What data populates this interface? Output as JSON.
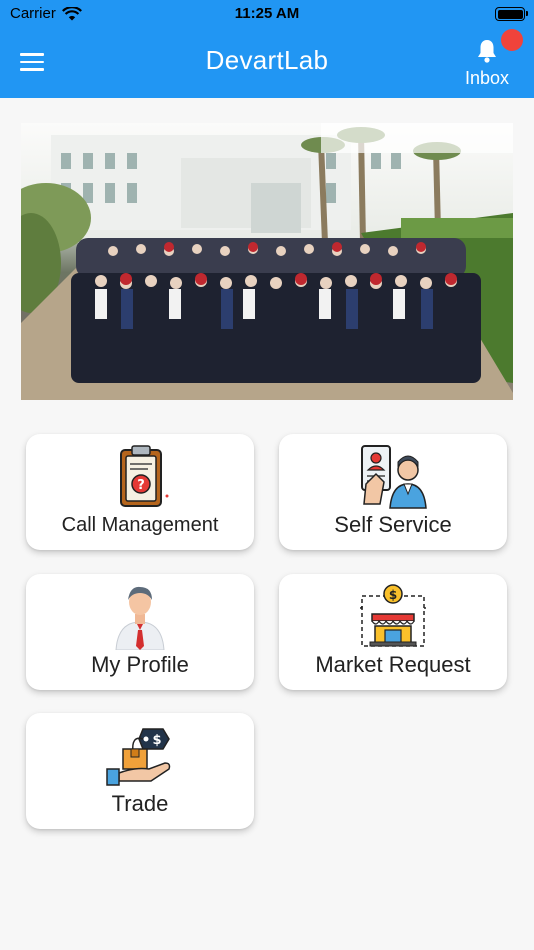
{
  "status_bar": {
    "carrier": "Carrier",
    "time": "11:25 AM"
  },
  "header": {
    "title": "DevartLab",
    "inbox_label": "Inbox",
    "accent_color": "#2196f3",
    "badge_color": "#f0433b"
  },
  "banner": {
    "description_icon": "group-photo"
  },
  "tiles": [
    {
      "label": "Call Management",
      "icon": "clipboard-question-icon"
    },
    {
      "label": "Self Service",
      "icon": "id-card-person-icon"
    },
    {
      "label": "My Profile",
      "icon": "businessman-icon"
    },
    {
      "label": "Market Request",
      "icon": "market-stall-icon"
    },
    {
      "label": "Trade",
      "icon": "hand-package-icon"
    }
  ]
}
